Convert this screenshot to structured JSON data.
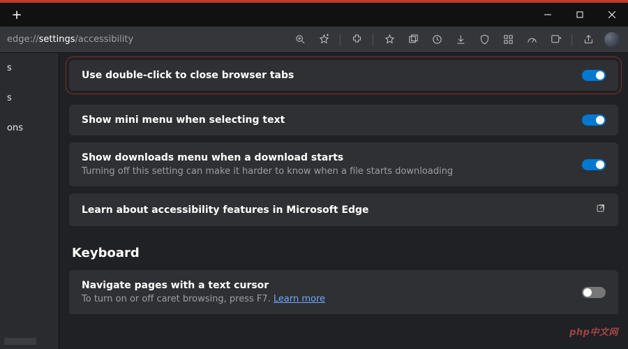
{
  "url": {
    "pre": "edge://",
    "bold": "settings",
    "post": "/accessibility"
  },
  "sidebar": {
    "items": [
      "s",
      "s",
      "ons"
    ]
  },
  "cards": {
    "doubleClick": {
      "title": "Use double-click to close browser tabs"
    },
    "miniMenu": {
      "title": "Show mini menu when selecting text"
    },
    "downloads": {
      "title": "Show downloads menu when a download starts",
      "sub": "Turning off this setting can make it harder to know when a file starts downloading"
    },
    "learn": {
      "title": "Learn about accessibility features in Microsoft Edge"
    },
    "caret": {
      "title": "Navigate pages with a text cursor",
      "sub_pre": "To turn on or off caret browsing, press F7. ",
      "sub_link": "Learn more"
    }
  },
  "section": {
    "keyboard": "Keyboard"
  },
  "watermark": "php中文网"
}
